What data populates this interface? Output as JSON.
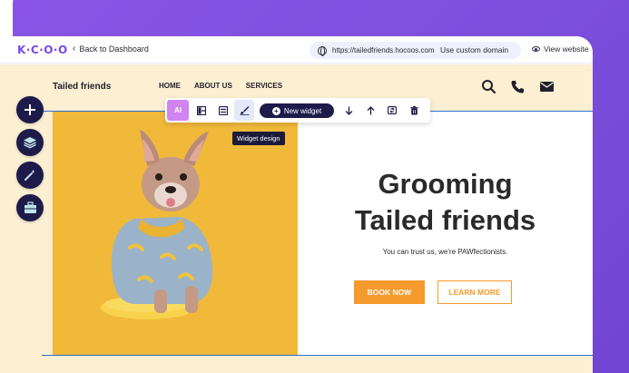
{
  "app": {
    "logo_text": "K·C·O·O",
    "back_label": "Back to Dashboard",
    "url": "https://tailedfriends.hocoos.com",
    "custom_domain_label": "Use custom domain",
    "view_website_label": "View website"
  },
  "site": {
    "logo": "Tailed friends",
    "nav": [
      "HOME",
      "ABOUT US",
      "SERVICES"
    ],
    "nav_icons": [
      "search-icon",
      "phone-icon",
      "mail-icon"
    ],
    "hero": {
      "heading_line1": "Grooming",
      "heading_line2": "Tailed friends",
      "subtitle": "You can trust us, we're PAWfectionists.",
      "primary_button": "BOOK NOW",
      "secondary_button": "LEARN MORE"
    }
  },
  "toolbar": {
    "ai_label": "AI",
    "new_widget_label": "New widget",
    "tooltip": "Widget design",
    "icons": [
      "layout-icon",
      "sliders-icon",
      "brush-icon",
      "arrow-down-icon",
      "arrow-up-icon",
      "swap-icon",
      "trash-icon"
    ]
  },
  "sidebar": {
    "buttons": [
      "add-icon",
      "layers-icon",
      "magic-wand-icon",
      "briefcase-icon"
    ]
  },
  "colors": {
    "brand_purple": "#7a4be0",
    "accent_orange": "#f59a2c",
    "selection_blue": "#2f6fd6",
    "dark_navy": "#1d1b4a",
    "site_background": "#fcefd2",
    "hero_photo_background": "#f1b93a"
  }
}
